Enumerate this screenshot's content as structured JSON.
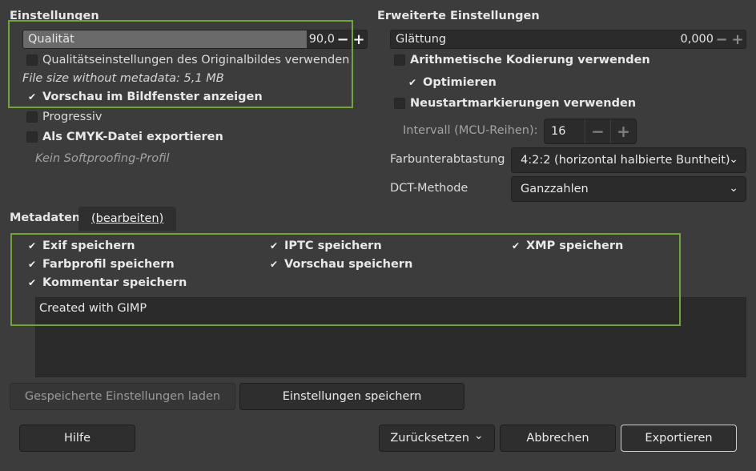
{
  "settings": {
    "title": "Einstellungen",
    "quality": {
      "label": "Qualität",
      "value": "90,0",
      "fraction": 0.9
    },
    "use_original_quality": {
      "label": "Qualitätseinstellungen des Originalbildes verwenden",
      "checked": false
    },
    "file_size_info": "File size without metadata: 5,1 MB",
    "preview_in_window": {
      "label": "Vorschau im Bildfenster anzeigen",
      "checked": true
    },
    "progressive": {
      "label": "Progressiv",
      "checked": false
    },
    "cmyk_export": {
      "label": "Als CMYK-Datei exportieren",
      "checked": false
    },
    "softproof_profile": "Kein Softproofing-Profil"
  },
  "advanced": {
    "title": "Erweiterte Einstellungen",
    "smoothing": {
      "label": "Glättung",
      "value": "0,000"
    },
    "arithmetic_coding": {
      "label": "Arithmetische Kodierung verwenden",
      "checked": false
    },
    "optimize": {
      "label": "Optimieren",
      "checked": true
    },
    "restart_markers": {
      "label": "Neustartmarkierungen verwenden",
      "checked": false
    },
    "interval": {
      "label": "Intervall (MCU-Reihen):",
      "value": "16"
    },
    "subsampling": {
      "label": "Farbunterabtastung",
      "value": "4:2:2 (horizontal halbierte Buntheit)"
    },
    "dct": {
      "label": "DCT-Methode",
      "value": "Ganzzahlen"
    }
  },
  "metadata": {
    "title": "Metadaten",
    "edit_label": "(bearbeiten)",
    "exif": {
      "label": "Exif speichern",
      "checked": true
    },
    "iptc": {
      "label": "IPTC speichern",
      "checked": true
    },
    "xmp": {
      "label": "XMP speichern",
      "checked": true
    },
    "color_profile": {
      "label": "Farbprofil speichern",
      "checked": true
    },
    "thumbnail": {
      "label": "Vorschau speichern",
      "checked": true
    },
    "comment": {
      "label": "Kommentar speichern",
      "checked": true
    },
    "comment_text": "Created with GIMP"
  },
  "presets": {
    "load_label": "Gespeicherte Einstellungen laden",
    "save_label": "Einstellungen speichern"
  },
  "footer": {
    "help_label": "Hilfe",
    "reset_label": "Zurücksetzen",
    "cancel_label": "Abbrechen",
    "export_label": "Exportieren"
  },
  "icons": {
    "check": "✔",
    "minus": "−",
    "plus": "+",
    "chevron": "⌄"
  },
  "colors": {
    "highlight": "#6fa735",
    "background": "#3c3c3c"
  }
}
